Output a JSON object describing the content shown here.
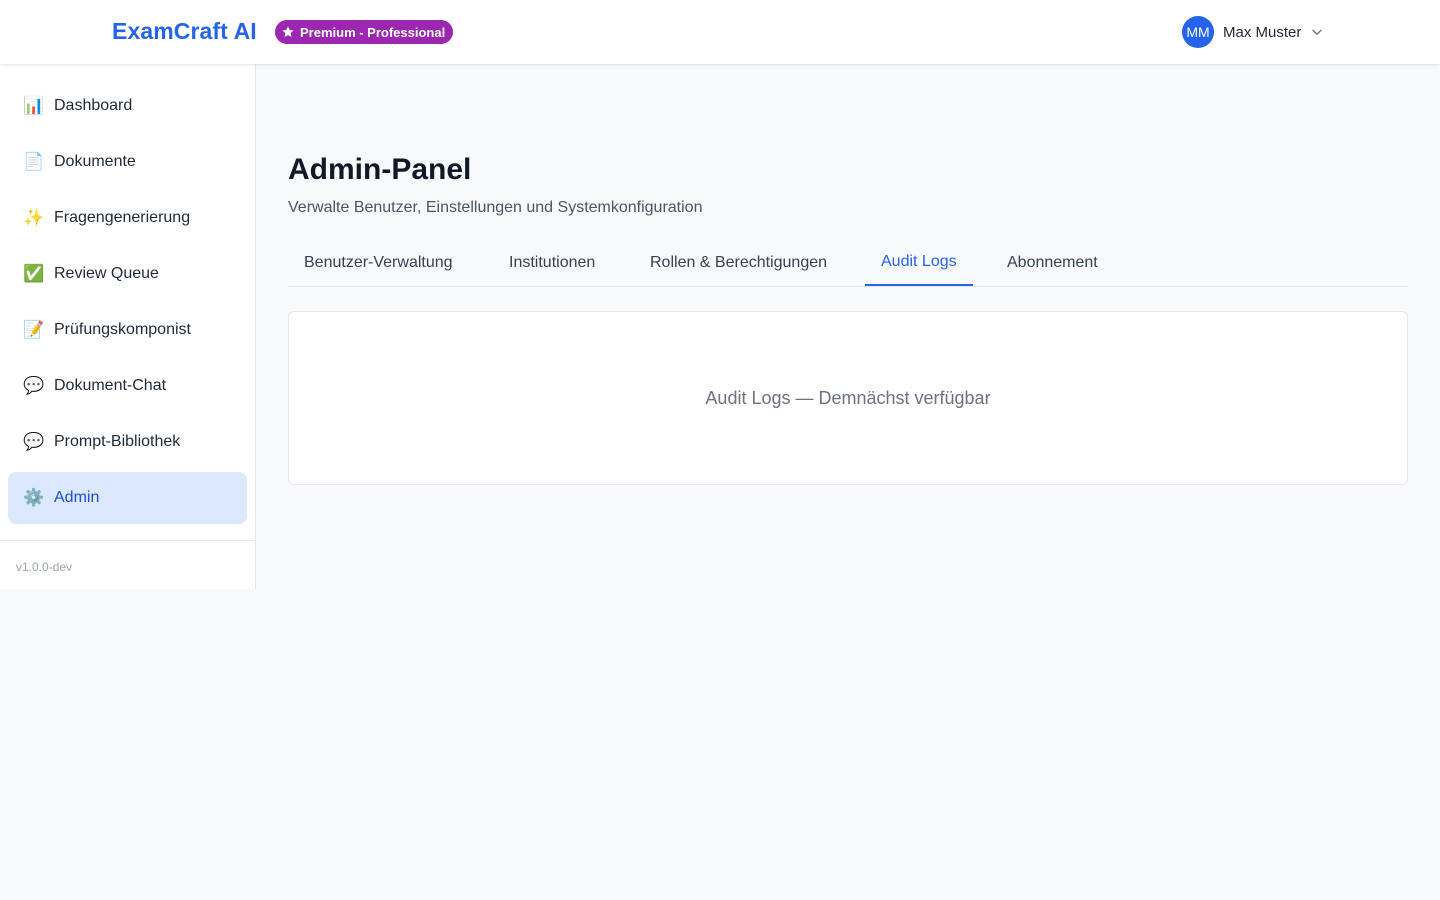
{
  "header": {
    "brand": "ExamCraft AI",
    "plan_badge": "Premium - Professional",
    "plan_icon": "star-icon",
    "user": {
      "initials": "MM",
      "name": "Max Muster"
    }
  },
  "sidebar": {
    "items": [
      {
        "icon": "📊",
        "icon_name": "bar-chart-icon",
        "label": "Dashboard"
      },
      {
        "icon": "📄",
        "icon_name": "document-icon",
        "label": "Dokumente"
      },
      {
        "icon": "✨",
        "icon_name": "sparkles-icon",
        "label": "Fragengenerierung"
      },
      {
        "icon": "✅",
        "icon_name": "check-mark-icon",
        "label": "Review Queue"
      },
      {
        "icon": "📝",
        "icon_name": "memo-icon",
        "label": "Prüfungskomponist"
      },
      {
        "icon": "💬",
        "icon_name": "speech-bubble-icon",
        "label": "Dokument-Chat"
      },
      {
        "icon": "💬",
        "icon_name": "speech-bubble-icon",
        "label": "Prompt-Bibliothek"
      },
      {
        "icon": "⚙️",
        "icon_name": "gear-icon",
        "label": "Admin",
        "active": true
      }
    ],
    "version": "v1.0.0-dev"
  },
  "main": {
    "title": "Admin-Panel",
    "subtitle": "Verwalte Benutzer, Einstellungen und Systemkonfiguration",
    "tabs": [
      {
        "label": "Benutzer-Verwaltung"
      },
      {
        "label": "Institutionen"
      },
      {
        "label": "Rollen & Berechtigungen"
      },
      {
        "label": "Audit Logs",
        "active": true
      },
      {
        "label": "Abonnement"
      }
    ],
    "placeholder": "Audit Logs — Demnächst verfügbar"
  },
  "colors": {
    "accent": "#2563eb",
    "badge": "#9c27b0",
    "active_nav_bg": "#dbe8fe",
    "page_bg": "#f8f9fb"
  }
}
